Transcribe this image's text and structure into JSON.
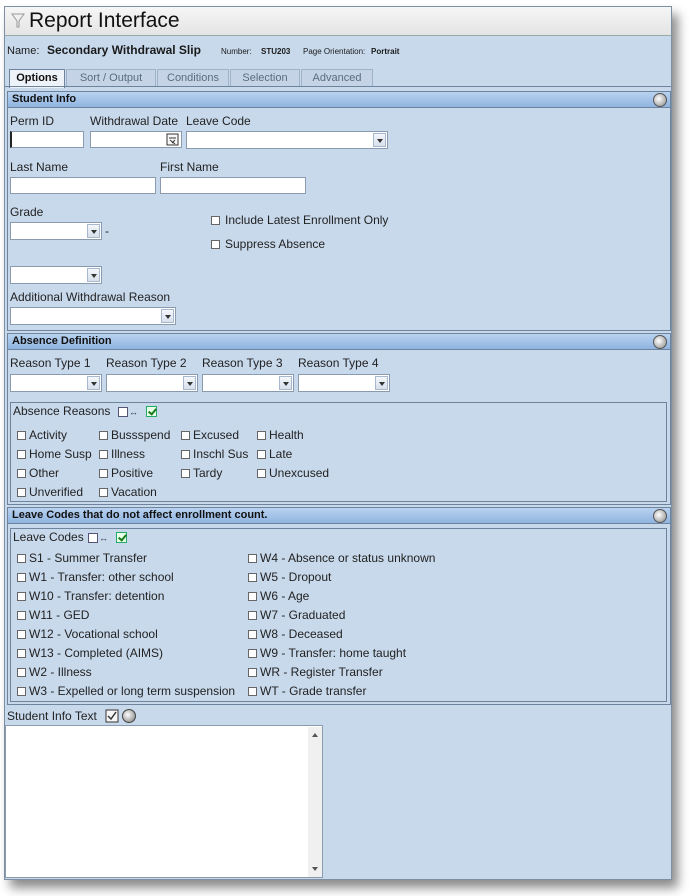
{
  "window": {
    "title": "Report Interface"
  },
  "report": {
    "name_label": "Name:",
    "name_value": "Secondary Withdrawal Slip",
    "number_label": "Number:",
    "number_value": "STU203",
    "orientation_label": "Page Orientation:",
    "orientation_value": "Portrait"
  },
  "tabs": [
    "Options",
    "Sort / Output",
    "Conditions",
    "Selection",
    "Advanced"
  ],
  "student_info": {
    "header": "Student Info",
    "perm_id_label": "Perm ID",
    "perm_id_value": "",
    "withdrawal_date_label": "Withdrawal Date",
    "leave_code_label": "Leave Code",
    "last_name_label": "Last Name",
    "first_name_label": "First Name",
    "grade_label": "Grade",
    "dash": "-",
    "include_latest_label": "Include Latest Enrollment Only",
    "suppress_absence_label": "Suppress Absence",
    "additional_reason_label": "Additional Withdrawal Reason"
  },
  "absence_definition": {
    "header": "Absence Definition",
    "reason_types": [
      "Reason Type 1",
      "Reason Type 2",
      "Reason Type 3",
      "Reason Type 4"
    ],
    "reasons_legend": "Absence Reasons",
    "reasons": [
      "Activity",
      "Bussspend",
      "Excused",
      "Health",
      "Home Susp",
      "Illness",
      "Inschl Sus",
      "Late",
      "Other",
      "Positive",
      "Tardy",
      "Unexcused",
      "Unverified",
      "Vacation"
    ]
  },
  "leave_codes": {
    "header": "Leave Codes that do not affect enrollment count.",
    "legend": "Leave Codes",
    "left": [
      "S1 - Summer Transfer",
      "W1 - Transfer: other school",
      "W10 - Transfer: detention",
      "W11 - GED",
      "W12 - Vocational school",
      "W13 - Completed (AIMS)",
      "W2 - Illness",
      "W3 - Expelled or long term suspension"
    ],
    "right": [
      "W4 - Absence or status unknown",
      "W5 - Dropout",
      "W6 - Age",
      "W7 - Graduated",
      "W8 - Deceased",
      "W9 - Transfer: home taught",
      "WR - Register Transfer",
      "WT - Grade transfer"
    ]
  },
  "student_info_text": {
    "label": "Student Info Text",
    "value": ""
  },
  "icons": [
    "filter-icon",
    "calendar-icon",
    "collapse-icon",
    "select-all-icon",
    "swap-icon",
    "check-all-icon",
    "spellcheck-icon",
    "help-icon"
  ]
}
